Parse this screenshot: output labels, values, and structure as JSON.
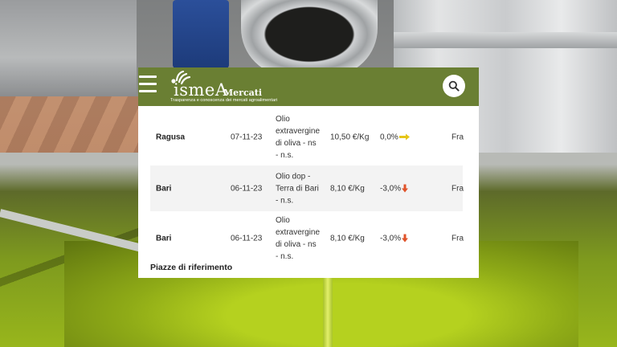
{
  "header": {
    "logo_word": "ismeA",
    "logo_sub": "Mercati",
    "tagline": "Trasparenza e conoscenza dei mercati agroalimentari",
    "menu_icon": "hamburger-icon",
    "search_icon": "search-icon",
    "brand_color": "#6a7f33"
  },
  "rows": [
    {
      "city": "Ragusa",
      "date": "07-11-23",
      "product_lines": [
        "Olio",
        "extravergine",
        "di oliva - ns",
        "- n.s."
      ],
      "price": "10,50 €/Kg",
      "variation": "0,0%",
      "trend": "stable",
      "trend_icon": "arrow-right-icon",
      "trend_color": "#e6c619",
      "extra": "Fra"
    },
    {
      "city": "Bari",
      "date": "06-11-23",
      "product_lines": [
        "Olio dop -",
        "Terra di Bari",
        "- n.s."
      ],
      "price": "8,10 €/Kg",
      "variation": "-3,0%",
      "trend": "down",
      "trend_icon": "arrow-down-icon",
      "trend_color": "#e0532a",
      "extra": "Fra"
    },
    {
      "city": "Bari",
      "date": "06-11-23",
      "product_lines": [
        "Olio",
        "extravergine",
        "di oliva - ns",
        "- n.s."
      ],
      "price": "8,10 €/Kg",
      "variation": "-3,0%",
      "trend": "down",
      "trend_icon": "arrow-down-icon",
      "trend_color": "#e0532a",
      "extra": "Fra"
    }
  ],
  "section_title": "Piazze di riferimento"
}
